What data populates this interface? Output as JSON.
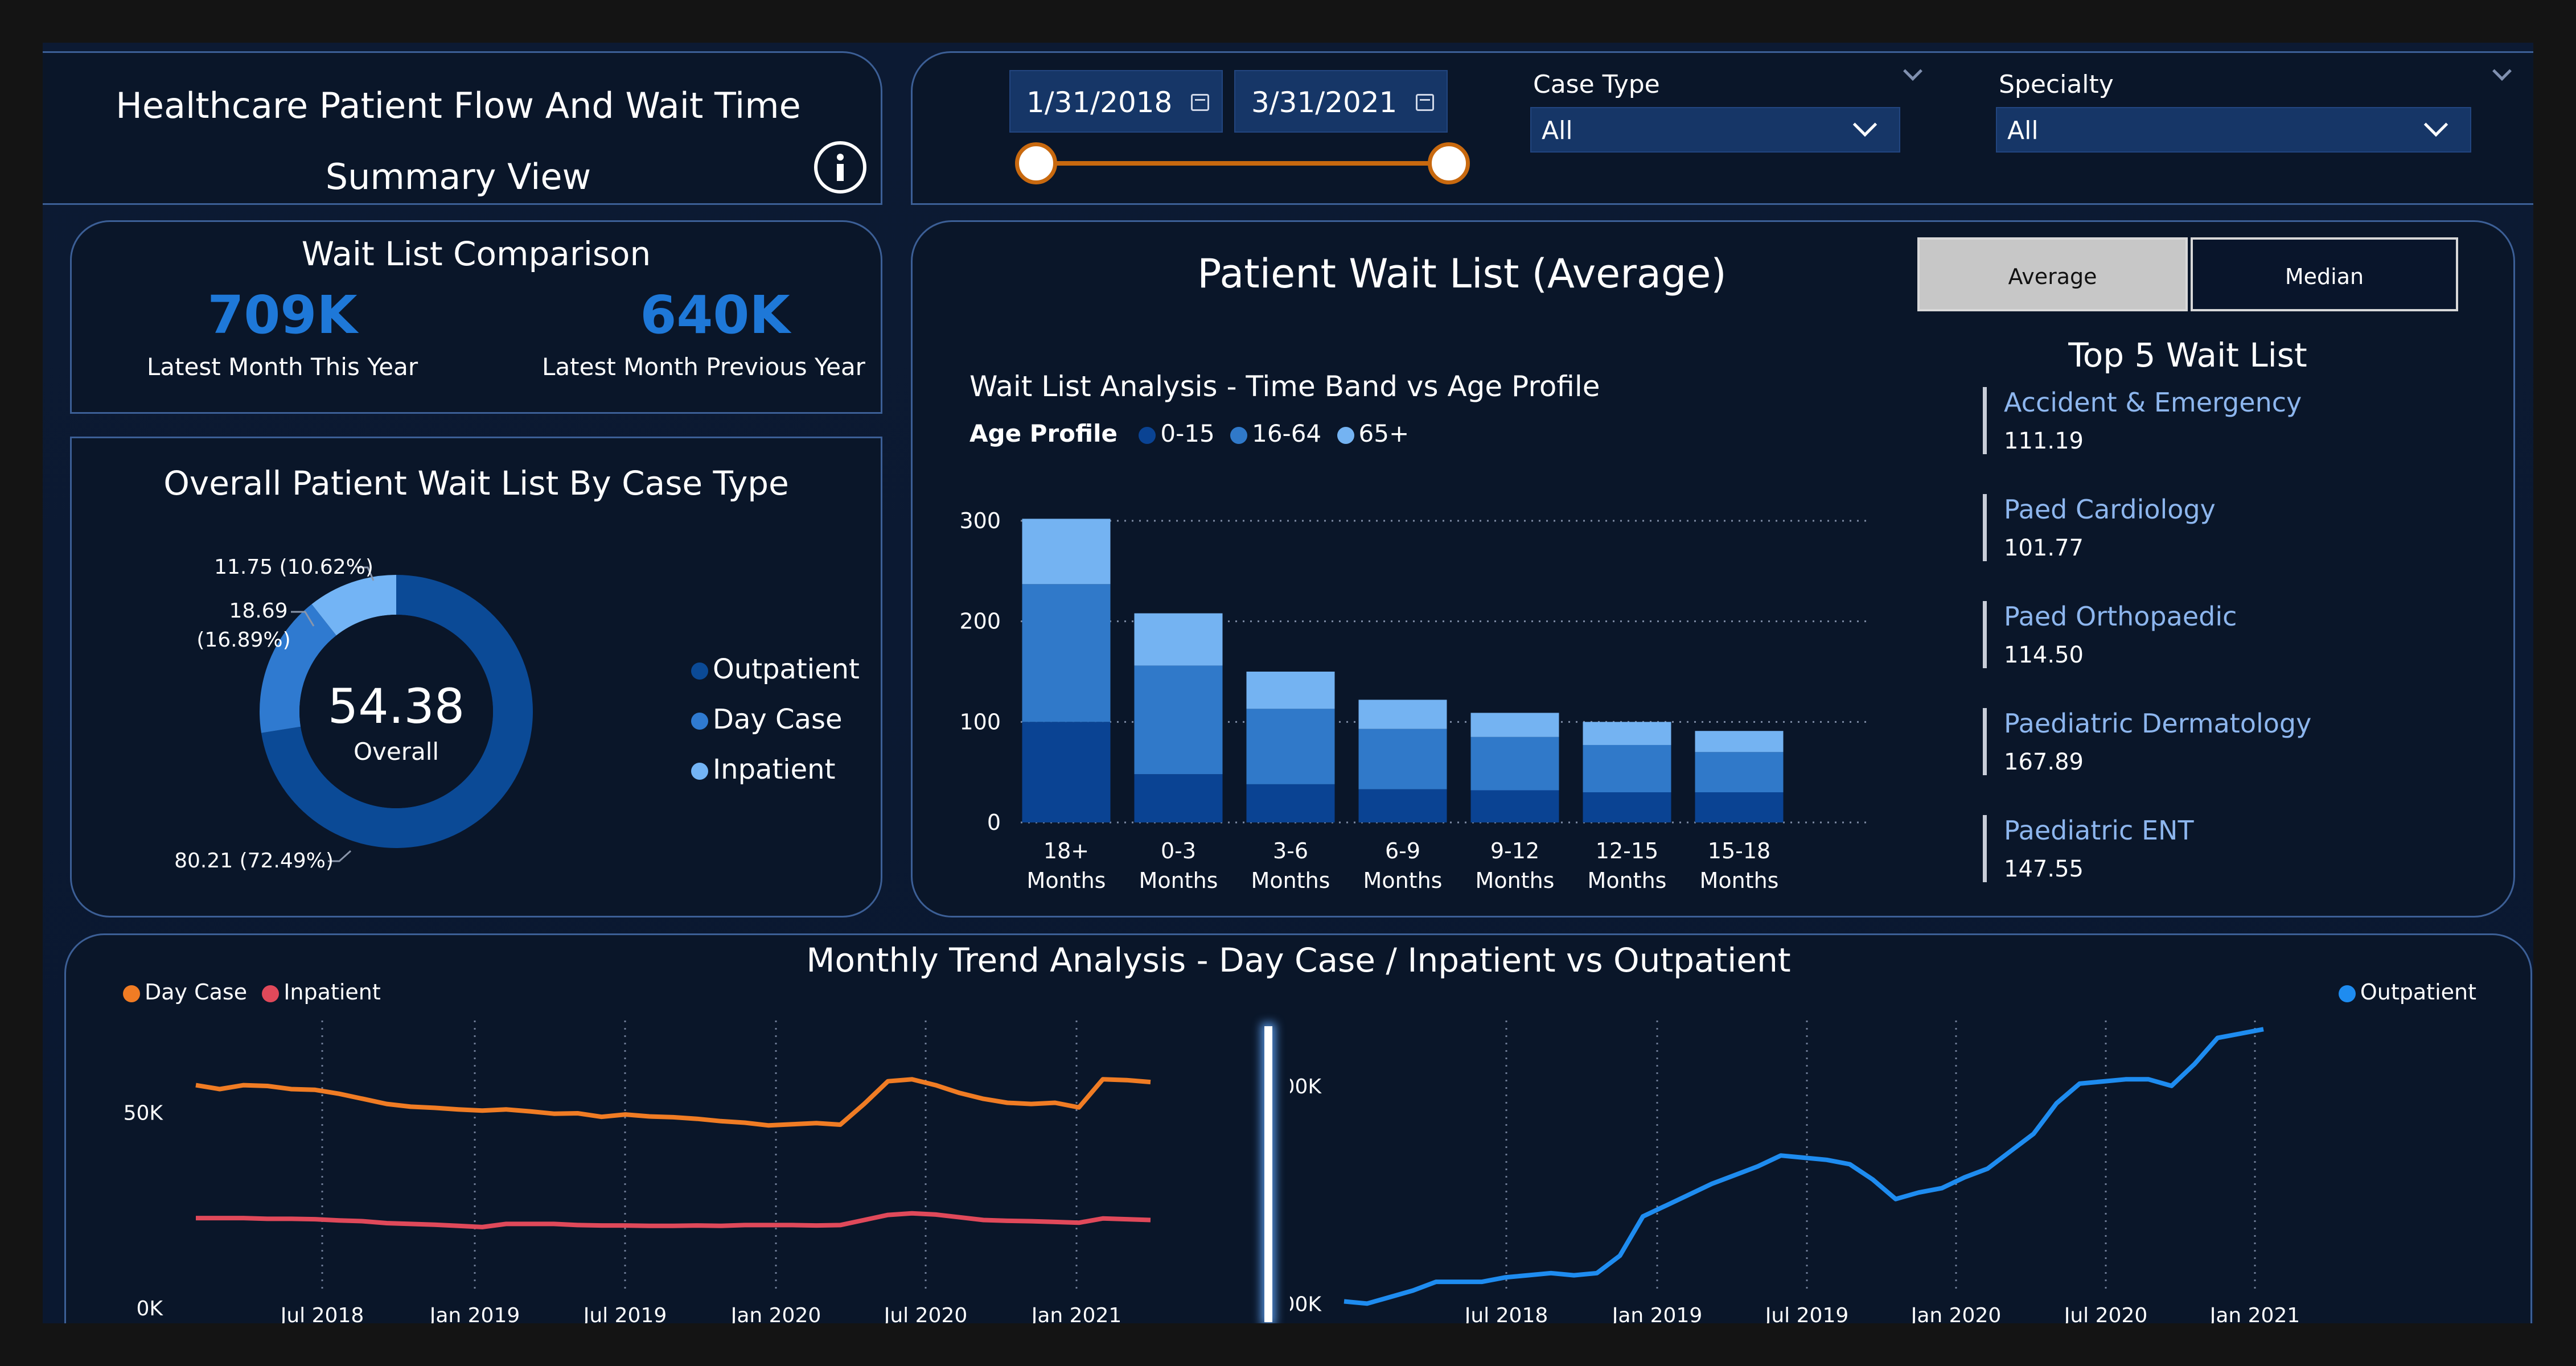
{
  "header": {
    "title_line1": "Healthcare Patient Flow And Wait Time",
    "title_line2": "Summary View",
    "info_icon": "info-icon"
  },
  "filters": {
    "date_start": "1/31/2018",
    "date_end": "3/31/2021",
    "case_type_label": "Case Type",
    "case_type_value": "All",
    "specialty_label": "Specialty",
    "specialty_value": "All"
  },
  "kpi": {
    "title": "Wait List Comparison",
    "this_year_value": "709K",
    "this_year_label": "Latest Month This Year",
    "prev_year_value": "640K",
    "prev_year_label": "Latest Month Previous Year"
  },
  "donut": {
    "title": "Overall Patient Wait List By Case Type",
    "center_value": "54.38",
    "center_label": "Overall",
    "label_outpatient": "80.21 (72.49%)",
    "label_daycase_1": "18.69",
    "label_daycase_2": "(16.89%)",
    "label_inpatient": "11.75 (10.62%)",
    "legend": [
      "Outpatient",
      "Day Case",
      "Inpatient"
    ]
  },
  "wait_panel": {
    "title": "Patient Wait List (Average)",
    "btn_average": "Average",
    "btn_median": "Median",
    "chart_title": "Wait List Analysis - Time Band vs Age Profile",
    "legend_title": "Age Profile",
    "top5_title": "Top 5 Wait List",
    "top5": [
      {
        "name": "Accident & Emergency",
        "value": "111.19"
      },
      {
        "name": "Paed Cardiology",
        "value": "101.77"
      },
      {
        "name": "Paed Orthopaedic",
        "value": "114.50"
      },
      {
        "name": "Paediatric Dermatology",
        "value": "167.89"
      },
      {
        "name": "Paediatric ENT",
        "value": "147.55"
      }
    ]
  },
  "trend": {
    "title": "Monthly Trend Analysis - Day Case / Inpatient  vs Outpatient",
    "legend_daycase": "Day Case",
    "legend_inpatient": "Inpatient",
    "legend_outpatient": "Outpatient"
  },
  "colors": {
    "outpatient": "#0b4a96",
    "daycase": "#2f7ad0",
    "inpatient": "#73b4f5",
    "age_0_15": "#0a4393",
    "age_16_64": "#3079c9",
    "age_65": "#74b3f2",
    "trend_daycase": "#f07c24",
    "trend_inpatient": "#e0495a",
    "trend_outpatient": "#1e8cf0",
    "slider": "#c8690f"
  },
  "chart_data": [
    {
      "type": "bar",
      "stacked": true,
      "title": "Wait List Analysis - Time Band vs Age Profile",
      "categories": [
        "18+ Months",
        "0-3 Months",
        "3-6 Months",
        "6-9 Months",
        "9-12 Months",
        "12-15 Months",
        "15-18 Months"
      ],
      "category_lines": [
        [
          "18+",
          "Months"
        ],
        [
          "0-3",
          "Months"
        ],
        [
          "3-6",
          "Months"
        ],
        [
          "6-9",
          "Months"
        ],
        [
          "9-12",
          "Months"
        ],
        [
          "12-15",
          "Months"
        ],
        [
          "15-18",
          "Months"
        ]
      ],
      "series": [
        {
          "name": "0-15",
          "values": [
            100,
            48,
            38,
            33,
            32,
            30,
            30
          ]
        },
        {
          "name": "16-64",
          "values": [
            137,
            108,
            75,
            60,
            53,
            47,
            40
          ]
        },
        {
          "name": "65+",
          "values": [
            65,
            52,
            37,
            29,
            24,
            23,
            21
          ]
        }
      ],
      "yticks": [
        0,
        100,
        200,
        300
      ],
      "ylim": [
        0,
        310
      ],
      "legend_title": "Age Profile",
      "legend_position": "top-left"
    },
    {
      "type": "pie",
      "variant": "donut",
      "title": "Overall Patient Wait List By Case Type",
      "slices": [
        {
          "name": "Outpatient",
          "value": 80.21,
          "percent": 72.49
        },
        {
          "name": "Day Case",
          "value": 18.69,
          "percent": 16.89
        },
        {
          "name": "Inpatient",
          "value": 11.75,
          "percent": 10.62
        }
      ],
      "legend_position": "right"
    },
    {
      "type": "line",
      "title": "Day Case / Inpatient",
      "x": [
        "2018-01",
        "2018-02",
        "2018-03",
        "2018-04",
        "2018-05",
        "2018-06",
        "2018-07",
        "2018-08",
        "2018-09",
        "2018-10",
        "2018-11",
        "2018-12",
        "2019-01",
        "2019-02",
        "2019-03",
        "2019-04",
        "2019-05",
        "2019-06",
        "2019-07",
        "2019-08",
        "2019-09",
        "2019-10",
        "2019-11",
        "2019-12",
        "2020-01",
        "2020-02",
        "2020-03",
        "2020-04",
        "2020-05",
        "2020-06",
        "2020-07",
        "2020-08",
        "2020-09",
        "2020-10",
        "2020-11",
        "2020-12",
        "2021-01",
        "2021-02",
        "2021-03"
      ],
      "series": [
        {
          "name": "Day Case",
          "values": [
            57.0,
            56.0,
            57.0,
            56.8,
            56.0,
            55.8,
            54.8,
            53.5,
            52.2,
            51.5,
            51.2,
            50.8,
            50.5,
            50.8,
            50.3,
            49.7,
            49.8,
            48.9,
            49.5,
            49.0,
            48.8,
            48.4,
            47.8,
            47.4,
            46.7,
            47.0,
            47.3,
            46.9,
            52.2,
            58.0,
            58.5,
            57.0,
            55.0,
            53.5,
            52.5,
            52.2,
            52.5,
            51.3,
            58.5,
            58.3,
            57.8
          ]
        },
        {
          "name": "Inpatient",
          "values": [
            23.0,
            23.0,
            23.0,
            22.8,
            22.8,
            22.7,
            22.4,
            22.2,
            21.7,
            21.5,
            21.3,
            21.0,
            20.7,
            21.5,
            21.5,
            21.5,
            21.2,
            21.1,
            21.1,
            21.0,
            21.0,
            21.1,
            21.0,
            21.2,
            21.2,
            21.2,
            21.1,
            21.2,
            22.5,
            23.8,
            24.2,
            23.9,
            23.2,
            22.5,
            22.3,
            22.2,
            22.0,
            21.8,
            22.9,
            22.7,
            22.5
          ]
        }
      ],
      "xticks": [
        "Jul 2018",
        "Jan 2019",
        "Jul 2019",
        "Jan 2020",
        "Jul 2020",
        "Jan 2021"
      ],
      "yticks": [
        "0K",
        "50K"
      ],
      "ylim": [
        0,
        75
      ],
      "legend_position": "top-left"
    },
    {
      "type": "line",
      "title": "Outpatient",
      "series": [
        {
          "name": "Outpatient",
          "values": [
            501,
            500,
            503,
            506,
            510,
            510,
            510,
            512,
            513,
            514,
            513,
            514,
            522,
            540,
            545,
            550,
            555,
            559,
            563,
            568,
            567,
            566,
            564,
            557,
            548,
            551,
            553,
            558,
            562,
            570,
            578,
            592,
            601,
            602,
            603,
            603,
            600,
            610,
            622,
            624,
            626
          ]
        }
      ],
      "xticks": [
        "Jul 2018",
        "Jan 2019",
        "Jul 2019",
        "Jan 2020",
        "Jul 2020",
        "Jan 2021"
      ],
      "yticks": [
        "500K",
        "600K"
      ],
      "ylim": [
        498,
        630
      ],
      "legend_position": "top-right"
    }
  ]
}
